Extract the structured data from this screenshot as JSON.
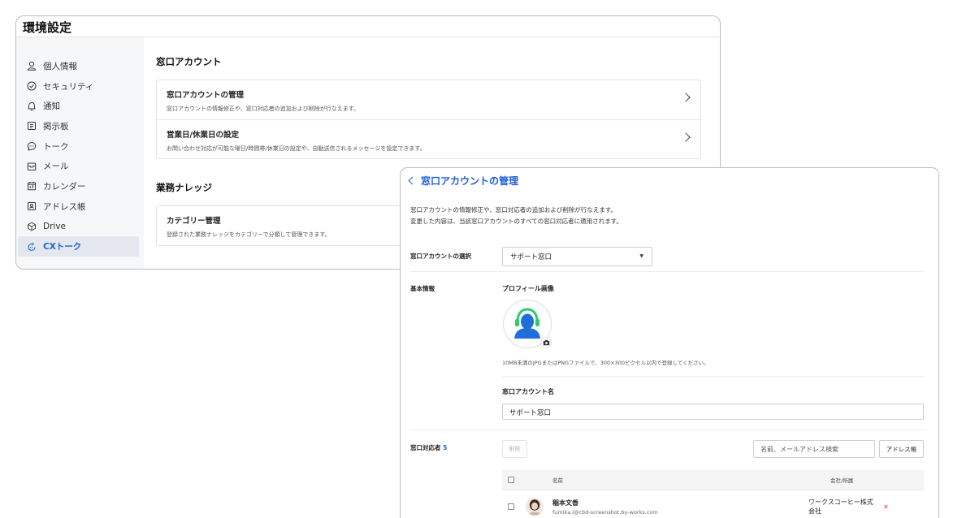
{
  "settings": {
    "title": "環境設定",
    "sidebar": [
      {
        "label": "個人情報",
        "icon": "user-icon"
      },
      {
        "label": "セキュリティ",
        "icon": "shield-check-icon"
      },
      {
        "label": "通知",
        "icon": "bell-icon"
      },
      {
        "label": "掲示板",
        "icon": "board-icon"
      },
      {
        "label": "トーク",
        "icon": "chat-icon"
      },
      {
        "label": "メール",
        "icon": "mail-icon"
      },
      {
        "label": "カレンダー",
        "icon": "calendar-icon"
      },
      {
        "label": "アドレス帳",
        "icon": "address-book-icon"
      },
      {
        "label": "Drive",
        "icon": "drive-icon"
      },
      {
        "label": "CXトーク",
        "icon": "cx-talk-icon",
        "active": true
      }
    ],
    "sections": [
      {
        "title": "窓口アカウント",
        "cards": [
          {
            "title": "窓口アカウントの管理",
            "desc": "窓口アカウントの情報修正や、窓口対応者の追加および削除が行なえます。"
          },
          {
            "title": "営業日/休業日の設定",
            "desc": "お問い合わせ対応が可能な曜日/時間帯/休業日の設定や、自動送信されるメッセージを設定できます。"
          }
        ]
      },
      {
        "title": "業務ナレッジ",
        "cards": [
          {
            "title": "カテゴリー管理",
            "desc": "登録された業務ナレッジをカテゴリーで分類して管理できます。"
          }
        ]
      }
    ]
  },
  "manage": {
    "title": "窓口アカウントの管理",
    "intro_line1": "窓口アカウントの情報修正や、窓口対応者の追加および削除が行なえます。",
    "intro_line2": "変更した内容は、当該窓口アカウントのすべての窓口対応者に適用されます。",
    "select_label": "窓口アカウントの選択",
    "select_value": "サポート窓口",
    "basic_info_label": "基本情報",
    "profile_image_label": "プロフィール画像",
    "image_hint": "10MB未満のJPGまたはPNGファイルで、300×300ピクセル以内で登録してください。",
    "account_name_label": "窓口アカウント名",
    "account_name_value": "サポート窓口",
    "agents_label": "窓口対応者",
    "agents_count": "5",
    "delete_button": "削除",
    "search_placeholder": "名前、メールアドレス検索",
    "address_book_button": "アドレス帳",
    "table_headers": {
      "name": "名前",
      "company": "会社/所属"
    },
    "rows": [
      {
        "name": "稲本文香",
        "email": "fumika.i@cbd-screenshot.by-works.com",
        "company": "ワークスコーヒー株式会社"
      }
    ],
    "colors": {
      "accent": "#1e5fd9",
      "avatar_green": "#2ecc71",
      "avatar_blue": "#1e6fd9",
      "remove": "#e0453a"
    }
  }
}
